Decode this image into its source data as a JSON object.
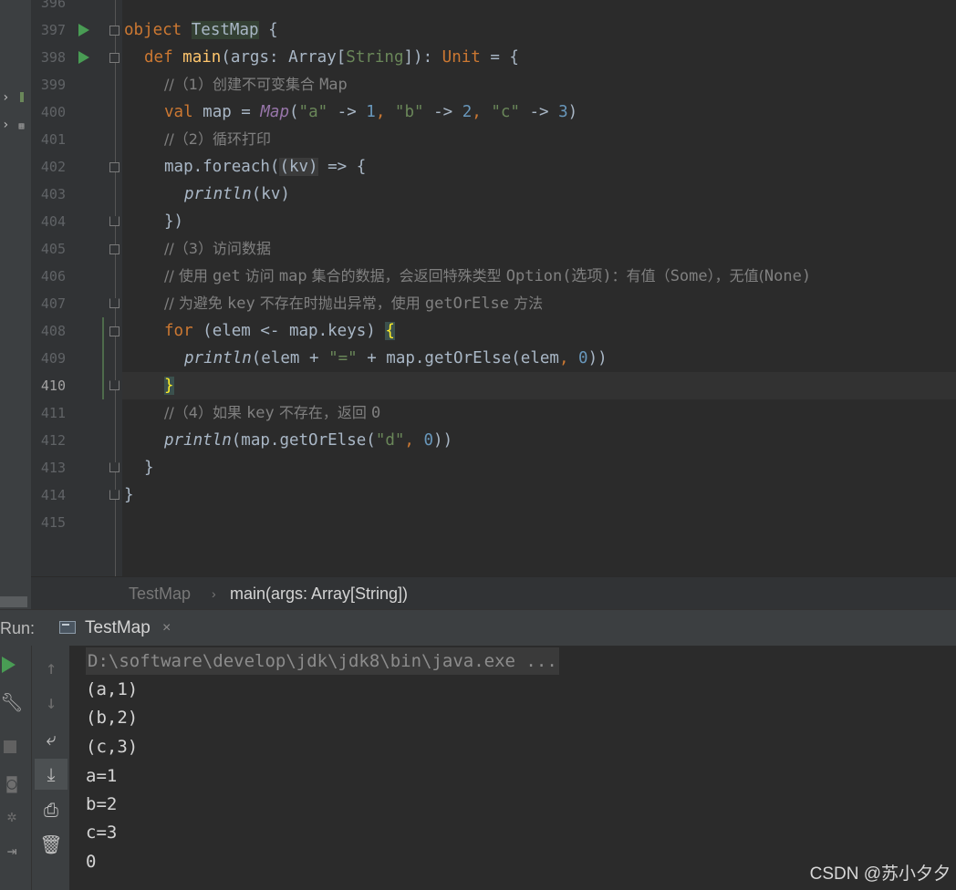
{
  "editor": {
    "line_numbers": [
      "396",
      "397",
      "398",
      "399",
      "400",
      "401",
      "402",
      "403",
      "404",
      "405",
      "406",
      "407",
      "408",
      "409",
      "410",
      "411",
      "412",
      "413",
      "414",
      "415"
    ],
    "current_line": "410",
    "tokens": {
      "l397_a": "object ",
      "l397_b": "TestMap",
      "l397_c": " {",
      "l398_a": "def ",
      "l398_b": "main",
      "l398_c": "(args: Array[",
      "l398_d": "String",
      "l398_e": "]): ",
      "l398_f": "Unit",
      "l398_g": " = {",
      "l399": "//（1）创建不可变集合 ",
      "l399_m": "Map",
      "l400_a": "val ",
      "l400_b": "map = ",
      "l400_c": "Map",
      "l400_d": "(",
      "l400_e": "\"a\"",
      "l400_f": " -> ",
      "l400_g": "1",
      "l400_h": ", ",
      "l400_i": "\"b\"",
      "l400_j": " -> ",
      "l400_k": "2",
      "l400_l": ", ",
      "l400_m": "\"c\"",
      "l400_n": " -> ",
      "l400_o": "3",
      "l400_p": ")",
      "l401": "//（2）循环打印",
      "l402_a": "map.foreach(",
      "l402_b": "(kv)",
      "l402_c": " => {",
      "l403_a": "println",
      "l403_b": "(kv)",
      "l404": "})",
      "l405": "//（3）访问数据",
      "l406_a": "// 使用 ",
      "l406_b": "get",
      "l406_c": " 访问 ",
      "l406_d": "map",
      "l406_e": " 集合的数据，会返回特殊类型 ",
      "l406_f": "Option(选项)",
      "l406_g": "：有值（",
      "l406_h": "Some",
      "l406_i": "），无值(",
      "l406_j": "None",
      "l406_k": ")",
      "l407_a": "// 为避免 ",
      "l407_b": "key",
      "l407_c": " 不存在时抛出异常，使用 ",
      "l407_d": "getOrElse",
      "l407_e": " 方法",
      "l408_a": "for ",
      "l408_b": "(elem <- map.keys) ",
      "l408_c": "{",
      "l409_a": "println",
      "l409_b": "(elem + ",
      "l409_c": "\"=\"",
      "l409_d": " + map.getOrElse(elem",
      "l409_e": ", ",
      "l409_f": "0",
      "l409_g": "))",
      "l410": "}",
      "l411_a": "//（4）如果 ",
      "l411_b": "key",
      "l411_c": " 不存在，返回 ",
      "l411_d": "0",
      "l412_a": "println",
      "l412_b": "(map.getOrElse(",
      "l412_c": "\"d\"",
      "l412_d": ", ",
      "l412_e": "0",
      "l412_f": "))",
      "l413": "}",
      "l414": "}"
    }
  },
  "breadcrumb": {
    "object": "TestMap",
    "separator": "›",
    "method": "main(args: Array[String])"
  },
  "run_panel": {
    "label": "Run:",
    "tab": {
      "label": "TestMap",
      "close": "×"
    },
    "command": "D:\\software\\develop\\jdk\\jdk8\\bin\\java.exe ...",
    "output": [
      "(a,1)",
      "(b,2)",
      "(c,3)",
      "a=1",
      "b=2",
      "c=3",
      "0"
    ]
  },
  "icons": {
    "rerun": "rerun-icon",
    "wrench": "wrench-icon",
    "stop": "stop-icon",
    "camera": "camera-icon",
    "bug": "bug-icon",
    "exit": "exit-icon",
    "up": "arrow-up-icon",
    "down": "arrow-down-icon",
    "wrap": "soft-wrap-icon",
    "scroll": "scroll-to-end-icon",
    "print": "print-icon",
    "trash": "trash-icon"
  },
  "watermark": "CSDN @苏小夕夕",
  "colors": {
    "background": "#2b2b2b",
    "keyword": "#cc7832",
    "string": "#6a8759",
    "number": "#6897bb",
    "function": "#ffc66d",
    "comment": "#808080",
    "run_green": "#499c54"
  }
}
